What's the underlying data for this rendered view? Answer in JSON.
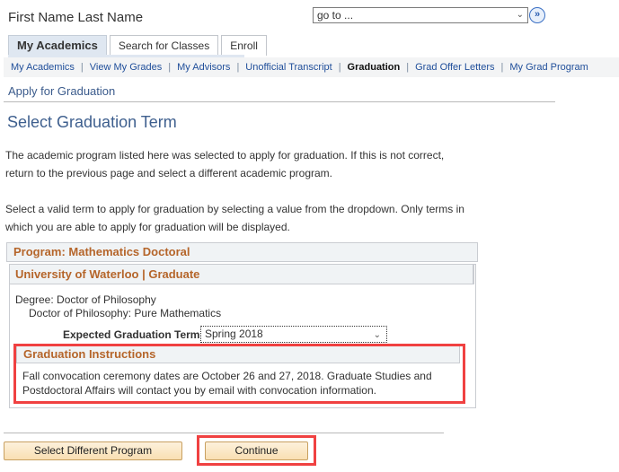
{
  "header": {
    "user_name": "First Name Last Name",
    "goto": {
      "value": "go to ...",
      "go_icon": "double-chevron-right-circle-icon"
    }
  },
  "tabs": [
    {
      "label": "My Academics",
      "active": true
    },
    {
      "label": "Search for Classes",
      "active": false
    },
    {
      "label": "Enroll",
      "active": false
    }
  ],
  "subnav": {
    "items": [
      {
        "label": "My Academics",
        "current": false
      },
      {
        "label": "View My Grades",
        "current": false
      },
      {
        "label": "My Advisors",
        "current": false
      },
      {
        "label": "Unofficial Transcript",
        "current": false
      },
      {
        "label": "Graduation",
        "current": true
      },
      {
        "label": "Grad Offer Letters",
        "current": false
      },
      {
        "label": "My Grad Program",
        "current": false
      }
    ],
    "separator": "|"
  },
  "page": {
    "section_title": "Apply for Graduation",
    "title": "Select Graduation Term",
    "para1": "The academic program listed here was selected to apply for graduation. If this is not correct, return to the previous page and select a different academic program.",
    "para2": "Select a valid term to apply for graduation by selecting a value from the dropdown. Only terms in which you are able to apply for graduation will be displayed."
  },
  "program": {
    "header": "Program: Mathematics Doctoral",
    "institution_header": "University of Waterloo | Graduate",
    "degree": "Degree: Doctor of Philosophy",
    "plan": "Doctor of Philosophy: Pure Mathematics",
    "expected_term_label": "Expected Graduation Term",
    "expected_term_value": "Spring 2018"
  },
  "instructions": {
    "header": "Graduation Instructions",
    "text": "Fall convocation ceremony dates are October 26 and 27, 2018.  Graduate Studies and Postdoctoral Affairs will contact you by email with convocation information."
  },
  "buttons": {
    "select_different_program": "Select Different Program",
    "continue": "Continue"
  },
  "highlight_color": "#f04141"
}
